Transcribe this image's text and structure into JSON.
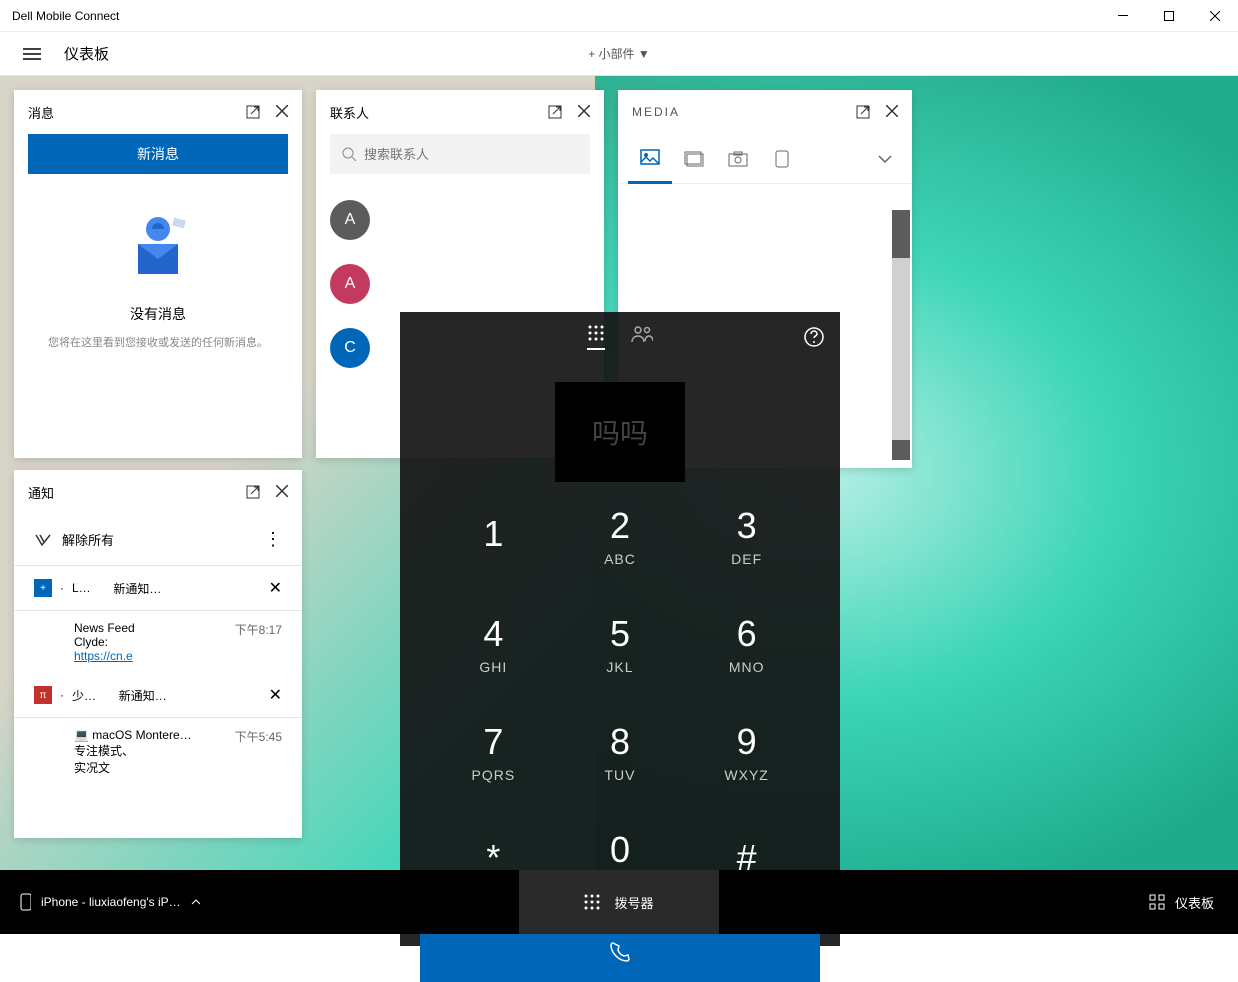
{
  "window": {
    "title": "Dell Mobile Connect"
  },
  "header": {
    "title": "仪表板",
    "add_widget": "+ 小部件 ▼"
  },
  "messages": {
    "title": "消息",
    "new_button": "新消息",
    "empty_title": "没有消息",
    "empty_desc": "您将在这里看到您接收或发送的任何新消息。"
  },
  "contacts": {
    "title": "联系人",
    "search_placeholder": "搜索联系人",
    "items": [
      {
        "initial": "A",
        "color": "grey"
      },
      {
        "initial": "A",
        "color": "red"
      },
      {
        "initial": "C",
        "color": "blue"
      }
    ]
  },
  "media": {
    "title": "MEDIA"
  },
  "notifications": {
    "title": "通知",
    "dismiss_all": "解除所有",
    "items": [
      {
        "badge_color": "blue",
        "badge_text": "+",
        "app": "L…",
        "head": "新通知…",
        "body_title": "News Feed",
        "time": "下午8:17",
        "body_line1": "Clyde:",
        "body_link": "https://cn.e"
      },
      {
        "badge_color": "red",
        "badge_text": "π",
        "app": "少…",
        "head": "新通知…",
        "body_title": "macOS Montere…",
        "time": "下午5:45",
        "body_line1": "专注模式、",
        "body_line2": "实况文"
      }
    ]
  },
  "dialer": {
    "placeholder": "吗吗",
    "keys": [
      {
        "d": "1",
        "l": ""
      },
      {
        "d": "2",
        "l": "ABC"
      },
      {
        "d": "3",
        "l": "DEF"
      },
      {
        "d": "4",
        "l": "GHI"
      },
      {
        "d": "5",
        "l": "JKL"
      },
      {
        "d": "6",
        "l": "MNO"
      },
      {
        "d": "7",
        "l": "PQRS"
      },
      {
        "d": "8",
        "l": "TUV"
      },
      {
        "d": "9",
        "l": "WXYZ"
      },
      {
        "d": "*",
        "l": ""
      },
      {
        "d": "0",
        "l": "+"
      },
      {
        "d": "#",
        "l": ""
      }
    ]
  },
  "bottombar": {
    "device": "iPhone - liuxiaofeng's iPho…",
    "center": "拨号器",
    "right": "仪表板"
  },
  "notif_detail_icon": "💻"
}
